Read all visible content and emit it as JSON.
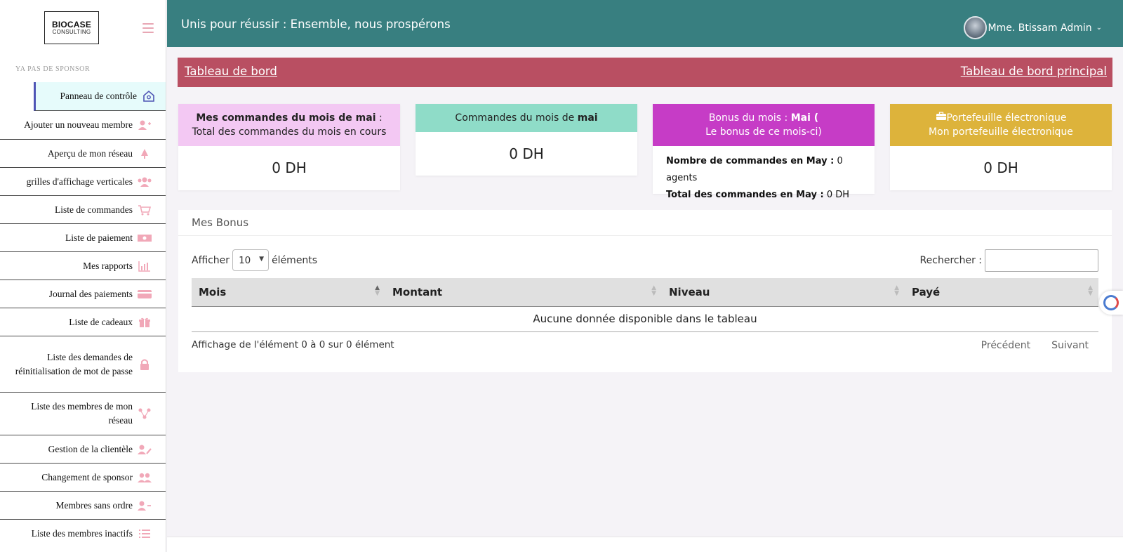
{
  "logo": {
    "line1": "BIOCASE",
    "line2": "CONSULTING"
  },
  "sidebar": {
    "sponsor": "YA PAS DE SPONSOR",
    "items": [
      {
        "label": "Panneau de contrôle",
        "icon": "home-icon",
        "glyph": "⌂"
      },
      {
        "label": "Ajouter un nouveau membre",
        "icon": "user-plus-icon",
        "glyph": "👤"
      },
      {
        "label": "Aperçu de mon réseau",
        "icon": "tree-icon",
        "glyph": "♣"
      },
      {
        "label": "grilles d'affichage verticales",
        "icon": "users-icon",
        "glyph": "👥"
      },
      {
        "label": "Liste de commandes",
        "icon": "cart-icon",
        "glyph": "🛒"
      },
      {
        "label": "Liste de paiement",
        "icon": "money-icon",
        "glyph": "▭"
      },
      {
        "label": "Mes rapports",
        "icon": "chart-icon",
        "glyph": "▥"
      },
      {
        "label": "Journal des paiements",
        "icon": "credit-card-icon",
        "glyph": "▬"
      },
      {
        "label": "Liste de cadeaux",
        "icon": "gift-icon",
        "glyph": "🎁"
      },
      {
        "label": "Liste des demandes de réinitialisation de mot de passe",
        "icon": "lock-icon",
        "glyph": "🔒"
      },
      {
        "label": "Liste des membres de mon réseau",
        "icon": "network-icon",
        "glyph": "⁂"
      },
      {
        "label": "Gestion de la clientèle",
        "icon": "user-edit-icon",
        "glyph": "✎"
      },
      {
        "label": "Changement de sponsor",
        "icon": "user-swap-icon",
        "glyph": "👥"
      },
      {
        "label": "Membres sans ordre",
        "icon": "user-minus-icon",
        "glyph": "👤"
      },
      {
        "label": "Liste des membres inactifs",
        "icon": "list-icon",
        "glyph": "☰"
      }
    ]
  },
  "header": {
    "slogan": "Unis pour réussir : Ensemble, nous prospérons",
    "user_name": "Mme. Btissam Admin"
  },
  "breadcrumb": {
    "left": "Tableau de bord",
    "right": "Tableau de bord principal"
  },
  "cards": {
    "orders_may": {
      "title_bold": "Mes commandes du mois de mai",
      "title_rest": " :",
      "subtitle": "Total des commandes du mois en cours",
      "value": "0 DH"
    },
    "orders_month": {
      "title": "Commandes du mois de ",
      "title_bold": "mai",
      "value": "0 DH"
    },
    "bonus": {
      "title": "Bonus du mois : ",
      "title_bold": "Mai (",
      "subtitle": "Le bonus de ce mois-ci)",
      "row1_label": "Nombre de commandes en May :",
      "row1_value": " 0 agents",
      "row2_label": "Total des commandes en May :",
      "row2_value": " 0 DH"
    },
    "wallet": {
      "title": "Portefeuille électronique",
      "subtitle": "Mon portefeuille électronique",
      "value": "0 DH"
    }
  },
  "bonus_table": {
    "title": "Mes Bonus",
    "show_label": "Afficher",
    "page_size": "10",
    "show_suffix": "éléments",
    "search_label": "Rechercher :",
    "columns": [
      "Mois",
      "Montant",
      "Niveau",
      "Payé"
    ],
    "empty": "Aucune donnée disponible dans le tableau",
    "info": "Affichage de l'élément 0 à 0 sur 0 élément",
    "prev": "Précédent",
    "next": "Suivant"
  },
  "colors": {
    "header": "#387f80",
    "breadcrumb": "#b94f62",
    "card1": "#f3c8f3",
    "card2": "#8fdcc8",
    "card3": "#c63cc6",
    "card4": "#ddb33b",
    "icon": "#f1a8b8"
  }
}
